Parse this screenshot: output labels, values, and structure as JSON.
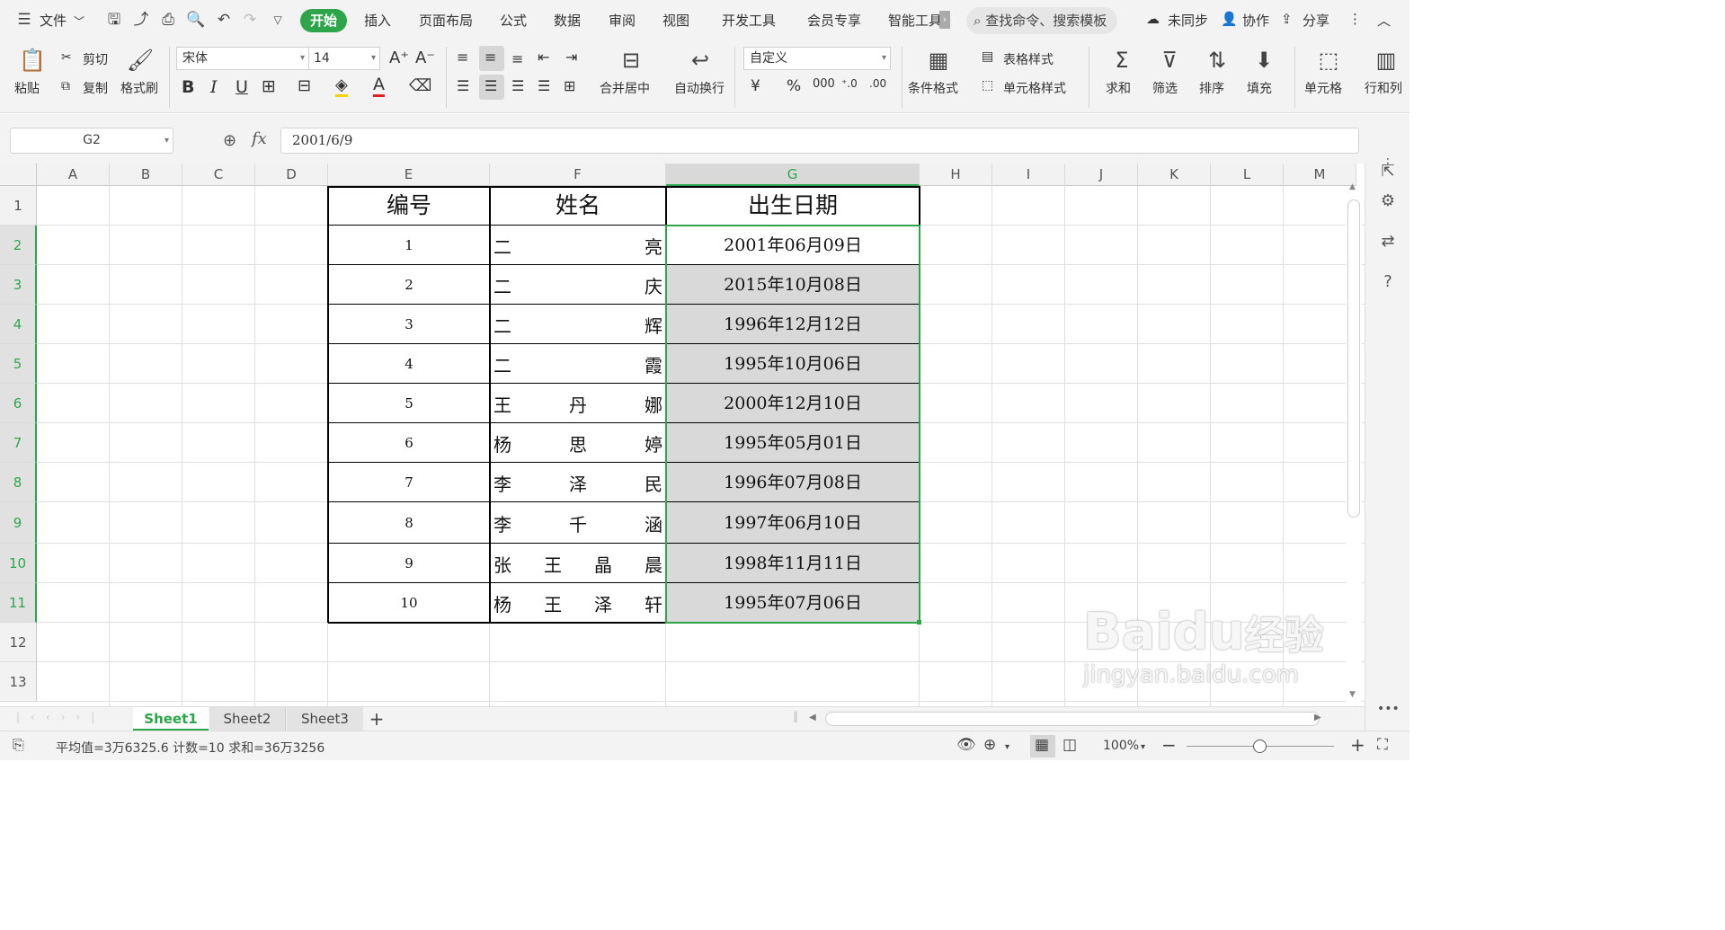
{
  "titlebar": {
    "file_menu": "文件",
    "tabs": [
      "开始",
      "插入",
      "页面布局",
      "公式",
      "数据",
      "审阅",
      "视图",
      "开发工具",
      "会员专享",
      "智能工具"
    ],
    "search_placeholder": "查找命令、搜索模板",
    "sync": "未同步",
    "collab": "协作",
    "share": "分享"
  },
  "ribbon": {
    "paste": "粘贴",
    "cut": "剪切",
    "copy": "复制",
    "format_painter": "格式刷",
    "font_name": "宋体",
    "font_size": "14",
    "merge_center": "合并居中",
    "wrap_text": "自动换行",
    "number_format": "自定义",
    "cond_format": "条件格式",
    "table_style": "表格样式",
    "cell_style": "单元格样式",
    "sum": "求和",
    "filter": "筛选",
    "sort": "排序",
    "fill": "填充",
    "cell": "单元格",
    "row_col": "行和列"
  },
  "formula": {
    "name_box": "G2",
    "fx": "fx",
    "value": "2001/6/9"
  },
  "grid": {
    "columns": [
      "A",
      "B",
      "C",
      "D",
      "E",
      "F",
      "G",
      "H",
      "I",
      "J",
      "K",
      "L",
      "M"
    ],
    "rows": [
      "1",
      "2",
      "3",
      "4",
      "5",
      "6",
      "7",
      "8",
      "9",
      "10",
      "11",
      "12",
      "13"
    ],
    "selected_col": "G",
    "header": {
      "id": "编号",
      "name": "姓名",
      "birth": "出生日期"
    },
    "records": [
      {
        "id": "1",
        "name": [
          "二",
          "亮"
        ],
        "birth": "2001年06月09日"
      },
      {
        "id": "2",
        "name": [
          "二",
          "庆"
        ],
        "birth": "2015年10月08日"
      },
      {
        "id": "3",
        "name": [
          "二",
          "辉"
        ],
        "birth": "1996年12月12日"
      },
      {
        "id": "4",
        "name": [
          "二",
          "霞"
        ],
        "birth": "1995年10月06日"
      },
      {
        "id": "5",
        "name": [
          "王",
          "丹",
          "娜"
        ],
        "birth": "2000年12月10日"
      },
      {
        "id": "6",
        "name": [
          "杨",
          "思",
          "婷"
        ],
        "birth": "1995年05月01日"
      },
      {
        "id": "7",
        "name": [
          "李",
          "泽",
          "民"
        ],
        "birth": "1996年07月08日"
      },
      {
        "id": "8",
        "name": [
          "李",
          "千",
          "涵"
        ],
        "birth": "1997年06月10日"
      },
      {
        "id": "9",
        "name": [
          "张",
          "王",
          "晶",
          "晨"
        ],
        "birth": "1998年11月11日"
      },
      {
        "id": "10",
        "name": [
          "杨",
          "王",
          "泽",
          "轩"
        ],
        "birth": "1995年07月06日"
      }
    ]
  },
  "sheets": {
    "tabs": [
      "Sheet1",
      "Sheet2",
      "Sheet3"
    ],
    "active": "Sheet1"
  },
  "status": {
    "summary": "平均值=3万6325.6  计数=10  求和=36万3256",
    "zoom": "100%",
    "zoom_level": 0.5
  },
  "watermark": {
    "brand": "Baidu",
    "brand_cn": "经验",
    "url": "jingyan.baidu.com"
  },
  "colors": {
    "accent": "#2ea54a",
    "selection_fill": "#d9d9d9"
  }
}
